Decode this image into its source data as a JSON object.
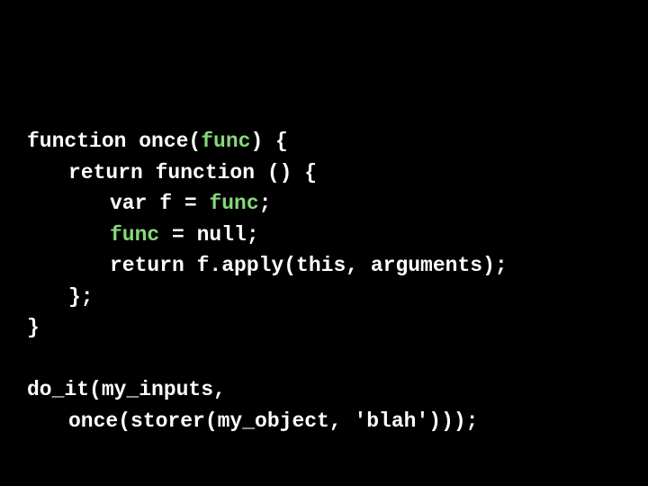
{
  "colors": {
    "background": "#000000",
    "text": "#ffffff",
    "highlight": "#86d97a"
  },
  "code": {
    "lines": [
      {
        "indent": 0,
        "segments": [
          {
            "cls": "kw",
            "text": "function once("
          },
          {
            "cls": "hl",
            "text": "func"
          },
          {
            "cls": "kw",
            "text": ") {"
          }
        ]
      },
      {
        "indent": 1,
        "segments": [
          {
            "cls": "kw",
            "text": "return function () {"
          }
        ]
      },
      {
        "indent": 2,
        "segments": [
          {
            "cls": "kw",
            "text": "var f = "
          },
          {
            "cls": "hl",
            "text": "func"
          },
          {
            "cls": "kw",
            "text": ";"
          }
        ]
      },
      {
        "indent": 2,
        "segments": [
          {
            "cls": "hl",
            "text": "func"
          },
          {
            "cls": "kw",
            "text": " = null;"
          }
        ]
      },
      {
        "indent": 2,
        "segments": [
          {
            "cls": "kw",
            "text": "return f.apply(this, arguments);"
          }
        ]
      },
      {
        "indent": 1,
        "segments": [
          {
            "cls": "kw",
            "text": "};"
          }
        ]
      },
      {
        "indent": 0,
        "segments": [
          {
            "cls": "kw",
            "text": "}"
          }
        ]
      },
      {
        "indent": 0,
        "segments": [
          {
            "cls": "kw",
            "text": ""
          }
        ]
      },
      {
        "indent": 0,
        "segments": [
          {
            "cls": "kw",
            "text": "do_it(my_inputs,"
          }
        ]
      },
      {
        "indent": 1,
        "segments": [
          {
            "cls": "kw",
            "text": "once(storer(my_object, 'blah')));"
          }
        ]
      }
    ]
  }
}
